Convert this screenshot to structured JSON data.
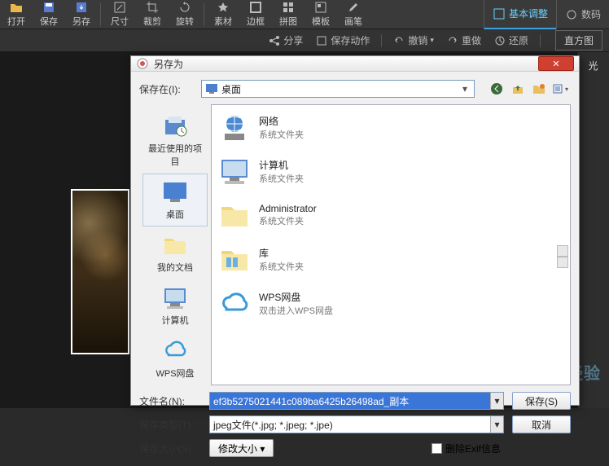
{
  "toolbar": {
    "open": "打开",
    "save": "保存",
    "saveAs": "另存",
    "size": "尺寸",
    "crop": "裁剪",
    "rotate": "旋转",
    "material": "素材",
    "border": "边框",
    "collage": "拼图",
    "template": "模板",
    "brush": "画笔"
  },
  "rightTabs": {
    "basic": "基本调整",
    "digital": "数码"
  },
  "secbar": {
    "share": "分享",
    "saveAction": "保存动作",
    "undo": "撤销",
    "redo": "重做",
    "restore": "还原",
    "histogram": "直方图"
  },
  "sidePanel": {
    "exposure": "光"
  },
  "dialog": {
    "title": "另存为",
    "saveInLabel": "保存在(I):",
    "location": "桌面",
    "places": {
      "recent": "最近使用的项目",
      "desktop": "桌面",
      "mydocs": "我的文档",
      "computer": "计算机",
      "wps": "WPS网盘"
    },
    "items": [
      {
        "name": "网络",
        "sub": "系统文件夹"
      },
      {
        "name": "计算机",
        "sub": "系统文件夹"
      },
      {
        "name": "Administrator",
        "sub": "系统文件夹"
      },
      {
        "name": "库",
        "sub": "系统文件夹"
      },
      {
        "name": "WPS网盘",
        "sub": "双击进入WPS网盘"
      }
    ],
    "fileNameLabel": "文件名(N):",
    "fileNameValue": "ef3b5275021441c089ba6425b26498ad_副本",
    "fileTypeLabel": "保存类型(T):",
    "fileTypeValue": "jpeg文件(*.jpg; *.jpeg; *.jpe)",
    "saveSizeLabel": "保存大小(S):",
    "modifySize": "修改大小 ▾",
    "deleteExif": "删除Exif信息",
    "saveBtn": "保存(S)",
    "cancelBtn": "取消"
  }
}
